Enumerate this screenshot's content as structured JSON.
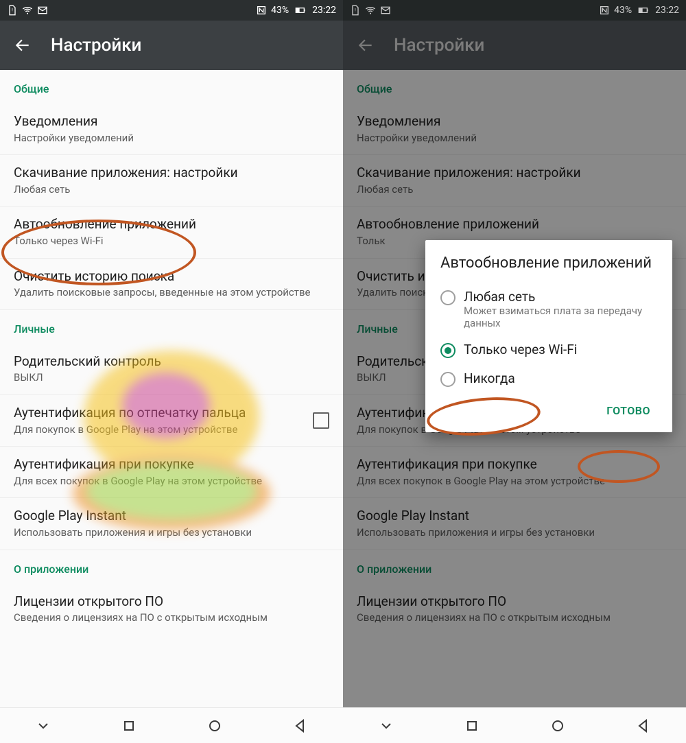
{
  "status": {
    "battery": "43%",
    "time": "23:22"
  },
  "header": {
    "title": "Настройки"
  },
  "sections": {
    "general": {
      "label": "Общие",
      "notifications": {
        "title": "Уведомления",
        "sub": "Настройки уведомлений"
      },
      "download": {
        "title": "Скачивание приложения: настройки",
        "sub": "Любая сеть"
      },
      "autoupdate": {
        "title": "Автообновление приложений",
        "sub": "Только через Wi-Fi"
      },
      "clearHistory": {
        "title": "Очистить историю поиска",
        "sub": "Удалить поисковые запросы, введенные на этом устройстве"
      }
    },
    "personal": {
      "label": "Личные",
      "parental": {
        "title": "Родительский контроль",
        "sub": "ВЫКЛ"
      },
      "fingerprint": {
        "title": "Аутентификация по отпечатку пальца",
        "sub": "Для покупок в Google Play на этом устройстве"
      },
      "purchaseAuth": {
        "title": "Аутентификация при покупке",
        "sub": "Для всех покупок в Google Play на этом устройстве"
      },
      "instant": {
        "title": "Google Play Instant",
        "sub": "Использовать приложения и игры без установки"
      }
    },
    "about": {
      "label": "О приложении",
      "licenses": {
        "title": "Лицензии открытого ПО",
        "sub": "Сведения о лицензиях на ПО с открытым исходным"
      }
    }
  },
  "dialog": {
    "title": "Автообновление приложений",
    "opt1": {
      "title": "Любая сеть",
      "sub": "Может взиматься плата за передачу данных"
    },
    "opt2": {
      "title": "Только через Wi-Fi"
    },
    "opt3": {
      "title": "Никогда"
    },
    "done": "ГОТОВО"
  },
  "left_autoupdate_sub_short": "Тольк"
}
